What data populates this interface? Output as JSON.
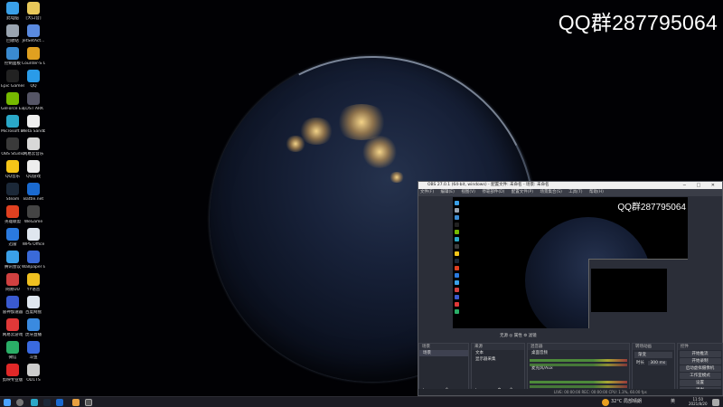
{
  "watermark": "QQ群287795064",
  "desktop_icons": [
    {
      "label": "此电脑",
      "color": "#3aa0e8"
    },
    {
      "label": "[大口音]",
      "color": "#e8c85a"
    },
    {
      "label": "回收站",
      "color": "#9aa4b0"
    },
    {
      "label": "JetSetAct...",
      "color": "#5a8ae0"
    },
    {
      "label": "控制面板",
      "color": "#3a8ad0"
    },
    {
      "label": "Counter-S Global Off...",
      "color": "#e0a020"
    },
    {
      "label": "Epic Games Launcher",
      "color": "#222"
    },
    {
      "label": "QQ",
      "color": "#2a9be8"
    },
    {
      "label": "GeForce Experience",
      "color": "#76b900"
    },
    {
      "label": "LOST ARK",
      "color": "#556"
    },
    {
      "label": "Microsoft Edge",
      "color": "#2aa8c8"
    },
    {
      "label": "Meta Sandbo...",
      "color": "#eee"
    },
    {
      "label": "OBS Studio",
      "color": "#3a3a3a"
    },
    {
      "label": "网易云音乐",
      "color": "#d8d8d8"
    },
    {
      "label": "QQ音乐",
      "color": "#f5c518"
    },
    {
      "label": "QQ游戏",
      "color": "#eee"
    },
    {
      "label": "Steam",
      "color": "#1b2838"
    },
    {
      "label": "Battle.net",
      "color": "#1a6ad0"
    },
    {
      "label": "英雄联盟",
      "color": "#e04020"
    },
    {
      "label": "WeGame",
      "color": "#444"
    },
    {
      "label": "迅雷",
      "color": "#2a7ae0"
    },
    {
      "label": "WPS Office",
      "color": "#dfe6ef"
    },
    {
      "label": "腾讯会议",
      "color": "#3aa0e8"
    },
    {
      "label": "Wallpaper Engine",
      "color": "#3a6ad8"
    },
    {
      "label": "网易UU",
      "color": "#d04040"
    },
    {
      "label": "YY语音",
      "color": "#f0c020"
    },
    {
      "label": "雷神加速器",
      "color": "#3a5ad0"
    },
    {
      "label": "百度网盘",
      "color": "#dfe6ef"
    },
    {
      "label": "网易云游戏",
      "color": "#e03838"
    },
    {
      "label": "虎牙直播",
      "color": "#3a8ae0"
    },
    {
      "label": "微信",
      "color": "#2aae67"
    },
    {
      "label": "斗鱼",
      "color": "#3a6ae0"
    },
    {
      "label": "剪映专业版",
      "color": "#e02828"
    },
    {
      "label": "OD1TS",
      "color": "#ccc"
    }
  ],
  "obs": {
    "title": "OBS 27.0.1 (64-bit, windows) - 配置文件: 未命名 - 场景: 未命名",
    "menu": [
      "文件(F)",
      "编辑(E)",
      "视图(V)",
      "停靠部件(D)",
      "配置文件(P)",
      "场景集合(S)",
      "工具(T)",
      "帮助(H)"
    ],
    "preview_watermark": "QQ群287795064",
    "scene_bar": "无源   ◎ 属性   ⚙ 滤镜",
    "docks": {
      "scenes": {
        "title": "场景",
        "items": [
          "场景"
        ]
      },
      "sources": {
        "title": "来源",
        "items": [
          "文本",
          "显示器采集"
        ]
      },
      "mixer": {
        "title": "混音器",
        "items": [
          "桌面音频",
          "麦克风/Aux"
        ]
      },
      "transitions": {
        "title": "转场动画",
        "type": "渐变",
        "duration_label": "时长",
        "duration": "300 ms"
      },
      "controls": {
        "title": "控件",
        "buttons": [
          "开始推流",
          "开始录制",
          "启动虚拟摄像机",
          "工作室模式",
          "设置",
          "退出"
        ]
      }
    },
    "status": "LIVE: 00:00:00   REC: 00:00:00   CPU: 1.3%, 60.00 fps"
  },
  "taskbar": {
    "weather": "32°C 局部晴朗",
    "time": "11:50",
    "date": "2021/8/20",
    "lang": "英"
  }
}
